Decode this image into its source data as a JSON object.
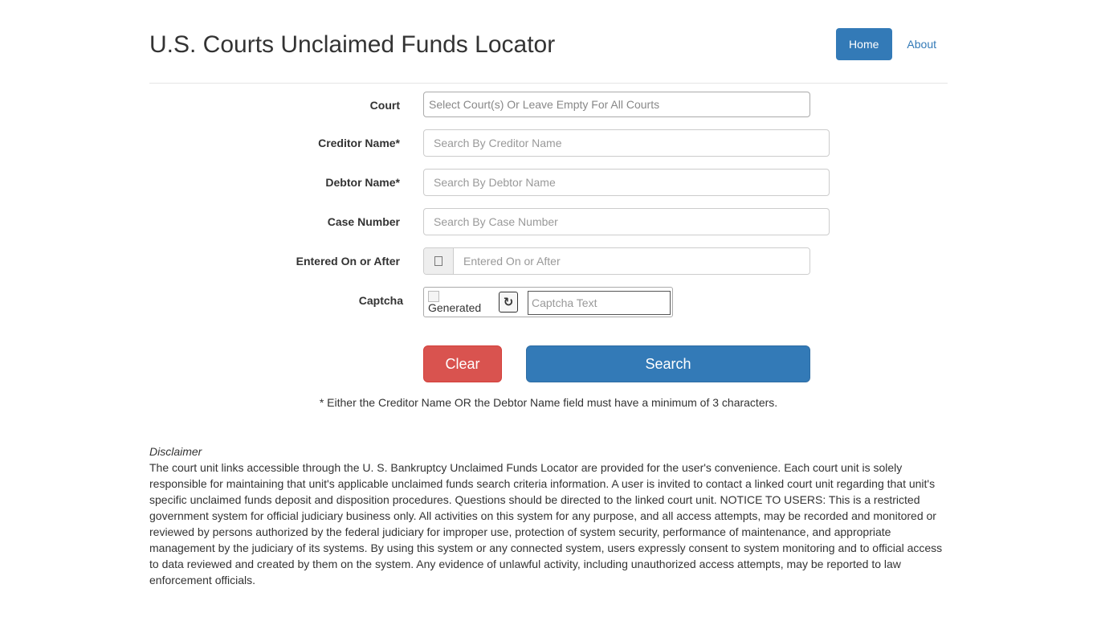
{
  "header": {
    "title": "U.S. Courts Unclaimed Funds Locator",
    "nav": {
      "home": "Home",
      "about": "About"
    }
  },
  "form": {
    "court": {
      "label": "Court",
      "placeholder": "Select Court(s) Or Leave Empty For All Courts",
      "value": ""
    },
    "creditor": {
      "label": "Creditor Name*",
      "placeholder": "Search By Creditor Name",
      "value": ""
    },
    "debtor": {
      "label": "Debtor Name*",
      "placeholder": "Search By Debtor Name",
      "value": ""
    },
    "case_number": {
      "label": "Case Number",
      "placeholder": "Search By Case Number",
      "value": ""
    },
    "entered_on": {
      "label": "Entered On or After",
      "placeholder": "Entered On or After",
      "value": "",
      "icon": "calendar-icon"
    },
    "captcha": {
      "label": "Captcha",
      "image_alt": "Generated",
      "placeholder": "Captcha Text",
      "value": "",
      "refresh_icon": "↻"
    }
  },
  "buttons": {
    "clear": "Clear",
    "search": "Search"
  },
  "note": "* Either the Creditor Name OR the Debtor Name field must have a minimum of 3 characters.",
  "disclaimer": {
    "title": "Disclaimer",
    "text": "The court unit links accessible through the U. S. Bankruptcy Unclaimed Funds Locator are provided for the user's convenience. Each court unit is solely responsible for maintaining that unit's applicable unclaimed funds search criteria information. A user is invited to contact a linked court unit regarding that unit's specific unclaimed funds deposit and disposition procedures. Questions should be directed to the linked court unit. NOTICE TO USERS: This is a restricted government system for official judiciary business only. All activities on this system for any purpose, and all access attempts, may be recorded and monitored or reviewed by persons authorized by the federal judiciary for improper use, protection of system security, performance of maintenance, and appropriate management by the judiciary of its systems. By using this system or any connected system, users expressly consent to system monitoring and to official access to data reviewed and created by them on the system. Any evidence of unlawful activity, including unauthorized access attempts, may be reported to law enforcement officials."
  },
  "colors": {
    "primary": "#337ab7",
    "danger": "#d9534f",
    "text": "#333333",
    "placeholder": "#999999"
  }
}
